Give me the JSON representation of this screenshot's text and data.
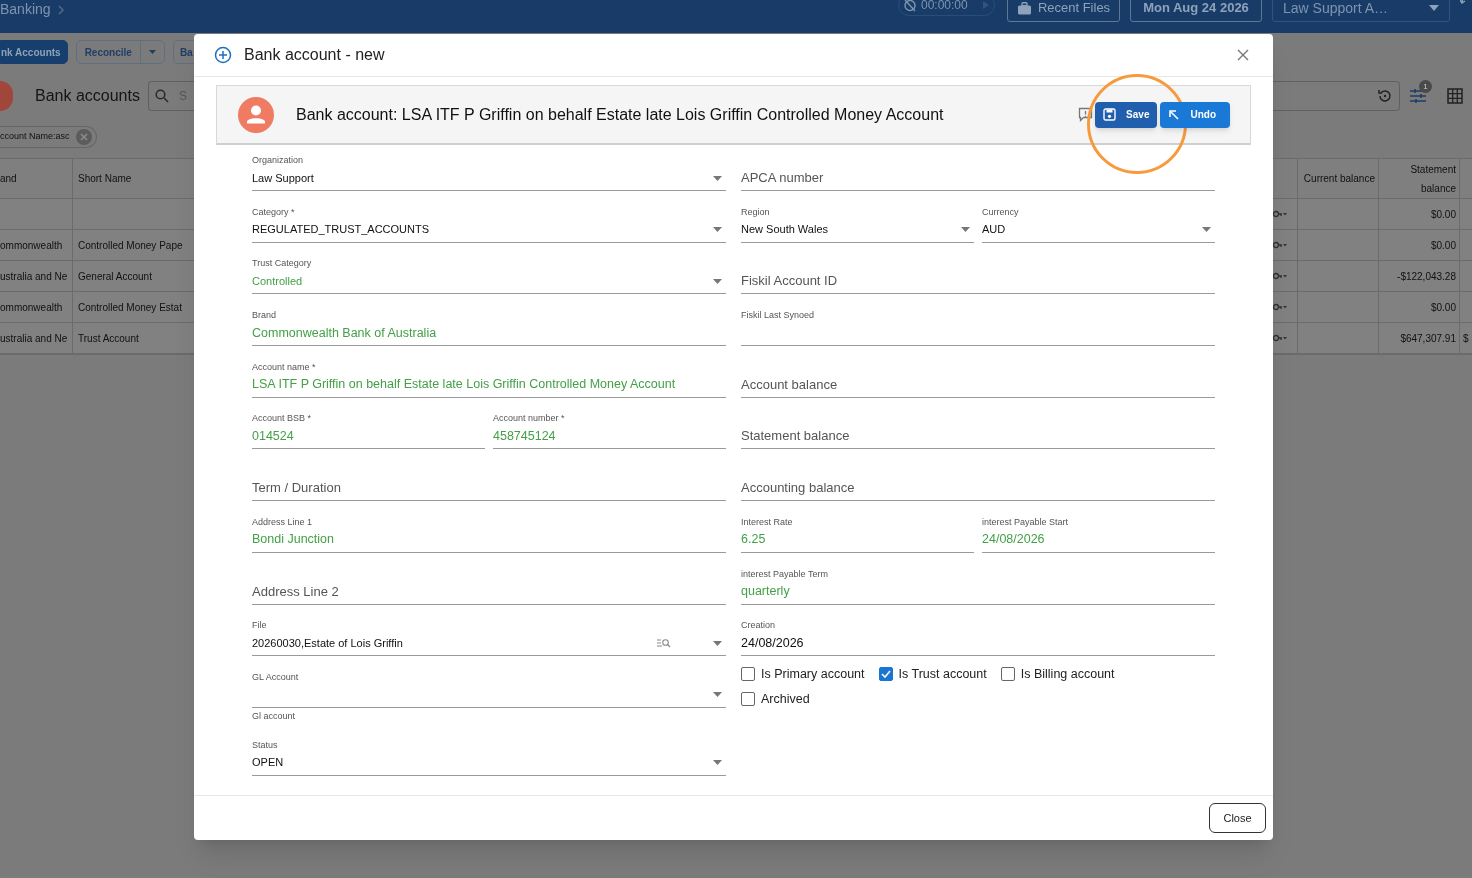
{
  "top_bar": {
    "breadcrumb": "Banking",
    "timer": "00:00:00",
    "recent_files": "Recent Files",
    "date": "Mon Aug 24 2026",
    "user": "Law Support A…"
  },
  "toolbar": [
    {
      "label": "nk Accounts",
      "selected": true,
      "kind": "plain"
    },
    {
      "label": "Reconcile",
      "selected": false,
      "kind": "split"
    },
    {
      "label": "Ba",
      "selected": false,
      "kind": "plain"
    }
  ],
  "page": {
    "title": "Bank accounts",
    "search_placeholder": "S",
    "filter_count": "1",
    "sort_chip": "ccount Name:asc"
  },
  "table": {
    "columns": [
      "and",
      "Short Name",
      "Current balance",
      "Statement balance"
    ],
    "rows": [
      {
        "statement_balance": "$0.00"
      },
      {
        "brand": "ommonwealth",
        "short_name": "Controlled Money Pape",
        "statement_balance": "$0.00"
      },
      {
        "brand": "ustralia and Ne",
        "short_name": "General Account",
        "statement_balance": "-$122,043.28"
      },
      {
        "brand": "ommonwealth",
        "short_name": "Controlled Money Estat",
        "statement_balance": "$0.00"
      },
      {
        "brand": "ustralia and Ne",
        "short_name": "Trust Account",
        "statement_balance": "$647,307.91",
        "column_6": "$"
      }
    ]
  },
  "dialog": {
    "title": "Bank account - new",
    "banner_title": "Bank account: LSA ITF P Griffin on behalf Estate late Lois Griffin Controlled Money Account",
    "buttons": [
      {
        "label": "Save",
        "kind": "save",
        "highlighted": true
      },
      {
        "label": "Undo",
        "kind": "undo",
        "highlighted": false
      }
    ],
    "left": [
      {
        "kind": "select",
        "label": "Organization",
        "value": "Law Support",
        "changed": false
      },
      {
        "kind": "select",
        "label": "Category *",
        "value": "REGULATED_TRUST_ACCOUNTS",
        "changed": false
      },
      {
        "kind": "select",
        "label": "Trust Category",
        "value": "Controlled",
        "changed": true
      },
      {
        "kind": "text",
        "label": "Brand",
        "value": "Commonwealth Bank of Australia",
        "changed": true
      },
      {
        "kind": "text",
        "label": "Account name *",
        "value": "LSA ITF P Griffin on behalf Estate late Lois Griffin Controlled Money Account",
        "changed": true
      },
      {
        "kind": "pair",
        "fields": [
          {
            "kind": "text",
            "label": "Account BSB *",
            "value": "014524",
            "changed": true
          },
          {
            "kind": "text",
            "label": "Account number *",
            "value": "458745124",
            "changed": true
          }
        ]
      },
      {
        "kind": "placeholder",
        "placeholder": "Term / Duration"
      },
      {
        "kind": "text",
        "label": "Address Line 1",
        "value": "Bondi Junction",
        "changed": true
      },
      {
        "kind": "placeholder",
        "placeholder": "Address Line 2"
      },
      {
        "kind": "file",
        "label": "File",
        "value": "20260030,Estate of Lois Griffin",
        "changed": false
      },
      {
        "kind": "select",
        "label": "GL Account"
      },
      {
        "kind": "hint",
        "text": "Gl account"
      },
      {
        "kind": "select",
        "label": "Status",
        "value": "OPEN",
        "changed": false
      }
    ],
    "right": [
      {
        "kind": "placeholder",
        "placeholder": "APCA number"
      },
      {
        "kind": "pair",
        "fields": [
          {
            "kind": "select",
            "label": "Region",
            "value": "New South Wales",
            "changed": false
          },
          {
            "kind": "select",
            "label": "Currency",
            "value": "AUD",
            "changed": false
          }
        ]
      },
      {
        "kind": "placeholder",
        "placeholder": "Fiskil Account ID"
      },
      {
        "kind": "text",
        "label": "Fiskil Last Synoed"
      },
      {
        "kind": "placeholder",
        "placeholder": "Account balance"
      },
      {
        "kind": "placeholder",
        "placeholder": "Statement balance"
      },
      {
        "kind": "placeholder",
        "placeholder": "Accounting balance"
      },
      {
        "kind": "pair",
        "fields": [
          {
            "kind": "text",
            "label": "Interest Rate",
            "value": "6.25",
            "changed": true
          },
          {
            "kind": "text",
            "label": "interest Payable Start",
            "value": "24/08/2026",
            "changed": true
          }
        ]
      },
      {
        "kind": "text",
        "label": "interest Payable Term",
        "value": "quarterly",
        "changed": true
      },
      {
        "kind": "text",
        "label": "Creation",
        "value": "24/08/2026",
        "changed": false
      }
    ],
    "checkboxes": [
      {
        "label": "Is Primary account",
        "checked": false
      },
      {
        "label": "Is Trust account",
        "checked": true
      },
      {
        "label": "Is Billing account",
        "checked": false
      },
      {
        "label": "Archived",
        "checked": false
      }
    ],
    "close": "Close"
  }
}
